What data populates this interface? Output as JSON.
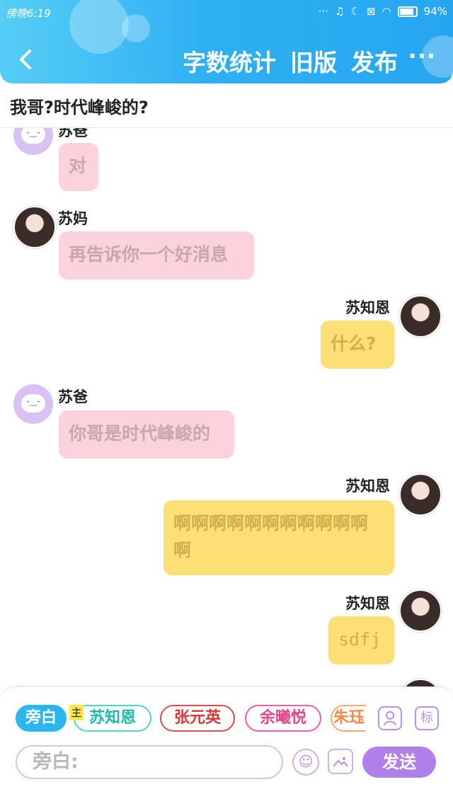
{
  "status_bar": {
    "time": "傍晚6:19",
    "battery": "94%"
  },
  "header": {
    "actions": [
      "字数统计",
      "旧版",
      "发布"
    ],
    "more": "···"
  },
  "title": "我哥?时代峰峻的?",
  "messages": [
    {
      "sender": "苏爸",
      "text": "对",
      "side": "left"
    },
    {
      "sender": "苏妈",
      "text": "再告诉你一个好消息",
      "side": "left"
    },
    {
      "sender": "苏知恩",
      "text": "什么?",
      "side": "right"
    },
    {
      "sender": "苏爸",
      "text": "你哥是时代峰峻的",
      "side": "left"
    },
    {
      "sender": "苏知恩",
      "text": "啊啊啊啊啊啊啊啊啊啊啊啊",
      "side": "right"
    },
    {
      "sender": "苏知恩",
      "text": "sdfj",
      "side": "right"
    },
    {
      "sender": "苏知恩",
      "text": "",
      "side": "right"
    }
  ],
  "characters": {
    "narration": "旁白",
    "main_tag": "主",
    "su": "苏知恩",
    "zhang": "张元英",
    "yu": "余曦悦",
    "zhu": "朱珏"
  },
  "tools": {
    "mark_label": "标"
  },
  "input": {
    "placeholder": "旁白:",
    "send": "发送"
  }
}
